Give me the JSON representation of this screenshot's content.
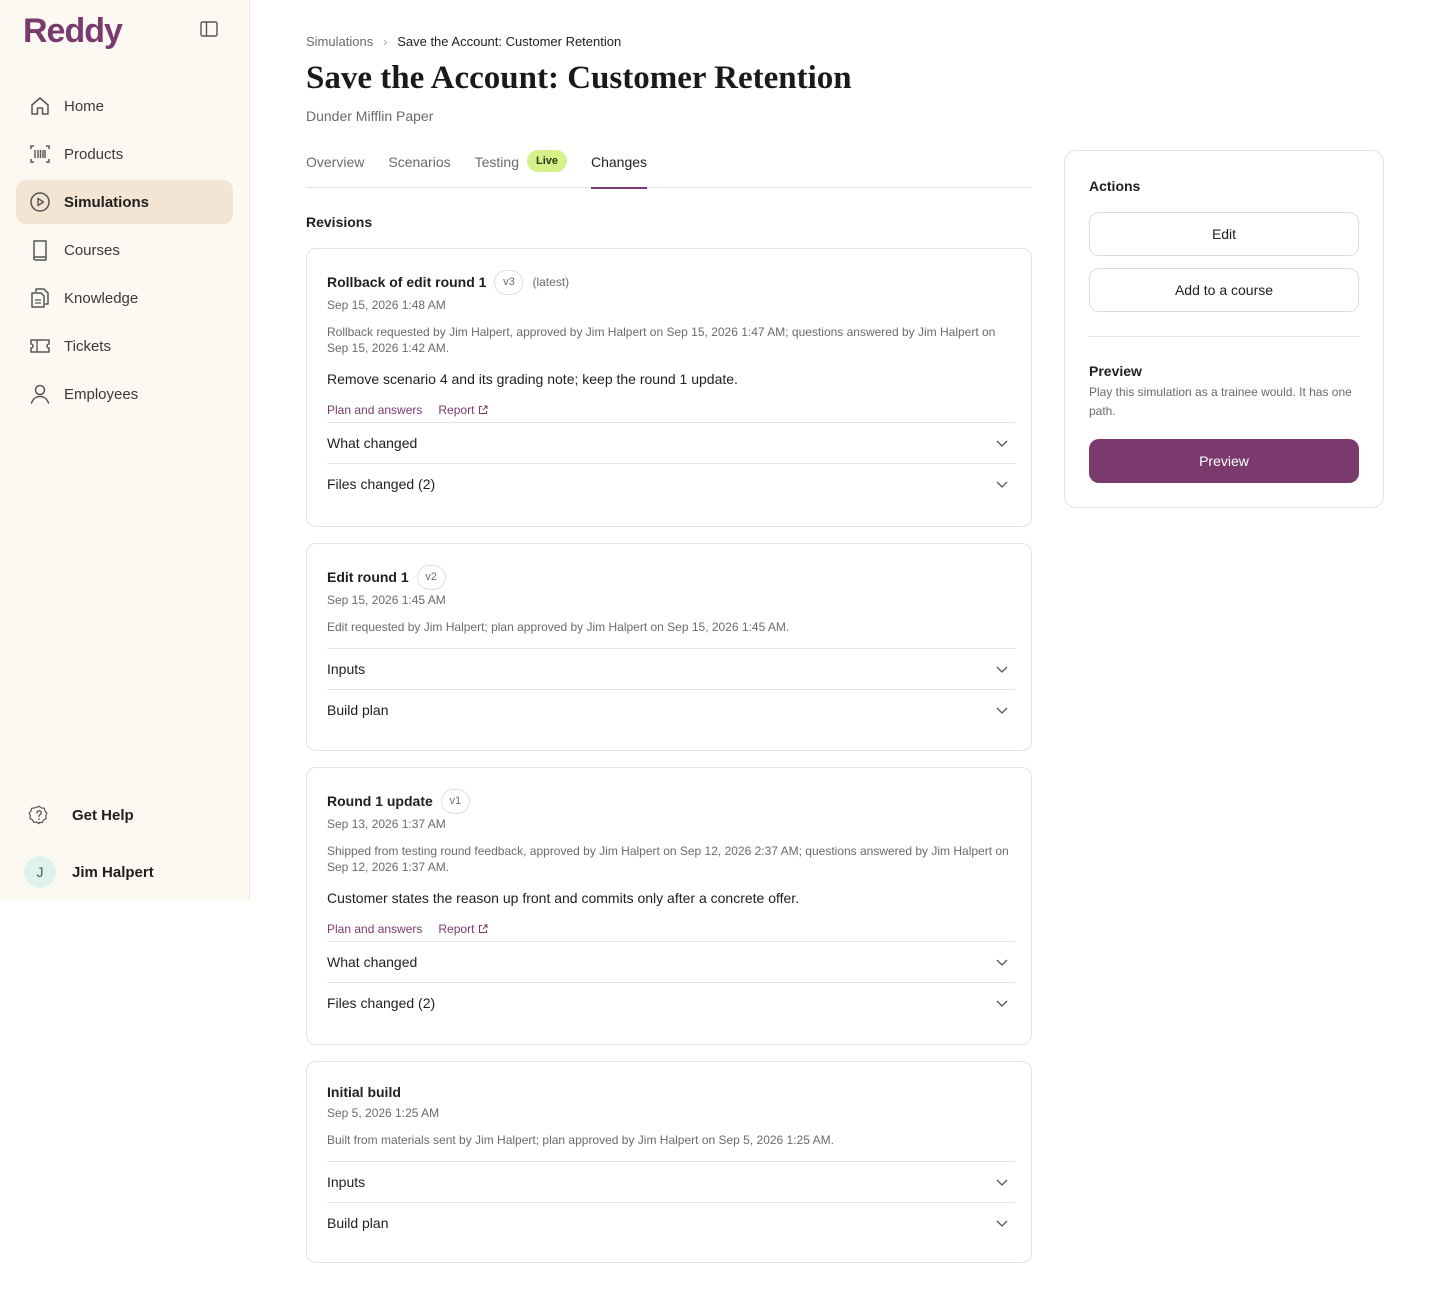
{
  "app": {
    "logo": "Reddy"
  },
  "sidebar": {
    "items": [
      {
        "label": "Home",
        "icon": "home-icon"
      },
      {
        "label": "Products",
        "icon": "barcode-icon"
      },
      {
        "label": "Simulations",
        "icon": "play-circle-icon",
        "active": true
      },
      {
        "label": "Courses",
        "icon": "book-icon"
      },
      {
        "label": "Knowledge",
        "icon": "documents-icon"
      },
      {
        "label": "Tickets",
        "icon": "ticket-icon"
      },
      {
        "label": "Employees",
        "icon": "user-icon"
      }
    ],
    "help_label": "Get Help",
    "user": {
      "initial": "J",
      "name": "Jim Halpert"
    }
  },
  "header": {
    "breadcrumb_root": "Simulations",
    "breadcrumb_current": "Save the Account: Customer Retention",
    "title": "Save the Account: Customer Retention",
    "subtitle": "Dunder Mifflin Paper"
  },
  "tabs": [
    {
      "label": "Overview"
    },
    {
      "label": "Scenarios"
    },
    {
      "label": "Testing",
      "badge": "Live"
    },
    {
      "label": "Changes",
      "active": true
    }
  ],
  "revisions": {
    "section_title": "Revisions",
    "items": [
      {
        "title": "Rollback of edit round 1",
        "version": "v3",
        "latest": "(latest)",
        "date": "Sep 15, 2026 1:48 AM",
        "meta": "Rollback requested by Jim Halpert, approved by Jim Halpert on Sep 15, 2026 1:47 AM; questions answered by Jim Halpert on Sep 15, 2026 1:42 AM.",
        "summary": "Remove scenario 4 and its grading note; keep the round 1 update.",
        "links": [
          "Plan and answers",
          "Report"
        ],
        "accordions": [
          "What changed",
          "Files changed (2)"
        ]
      },
      {
        "title": "Edit round 1",
        "version": "v2",
        "date": "Sep 15, 2026 1:45 AM",
        "meta": "Edit requested by Jim Halpert; plan approved by Jim Halpert on Sep 15, 2026 1:45 AM.",
        "accordions": [
          "Inputs",
          "Build plan"
        ]
      },
      {
        "title": "Round 1 update",
        "version": "v1",
        "date": "Sep 13, 2026 1:37 AM",
        "meta": "Shipped from testing round feedback, approved by Jim Halpert on Sep 12, 2026 2:37 AM; questions answered by Jim Halpert on Sep 12, 2026 1:37 AM.",
        "summary": "Customer states the reason up front and commits only after a concrete offer.",
        "links": [
          "Plan and answers",
          "Report"
        ],
        "accordions": [
          "What changed",
          "Files changed (2)"
        ]
      },
      {
        "title": "Initial build",
        "date": "Sep 5, 2026 1:25 AM",
        "meta": "Built from materials sent by Jim Halpert; plan approved by Jim Halpert on Sep 5, 2026 1:25 AM.",
        "accordions": [
          "Inputs",
          "Build plan"
        ]
      }
    ]
  },
  "actions": {
    "title": "Actions",
    "edit_label": "Edit",
    "add_course_label": "Add to a course",
    "preview_title": "Preview",
    "preview_desc": "Play this simulation as a trainee would. It has one path.",
    "preview_button": "Preview"
  },
  "colors": {
    "accent": "#7a3a6e",
    "live_badge": "#d7f08a",
    "sidebar_bg": "#fcf8f2",
    "active_nav": "#f3e4d3"
  }
}
